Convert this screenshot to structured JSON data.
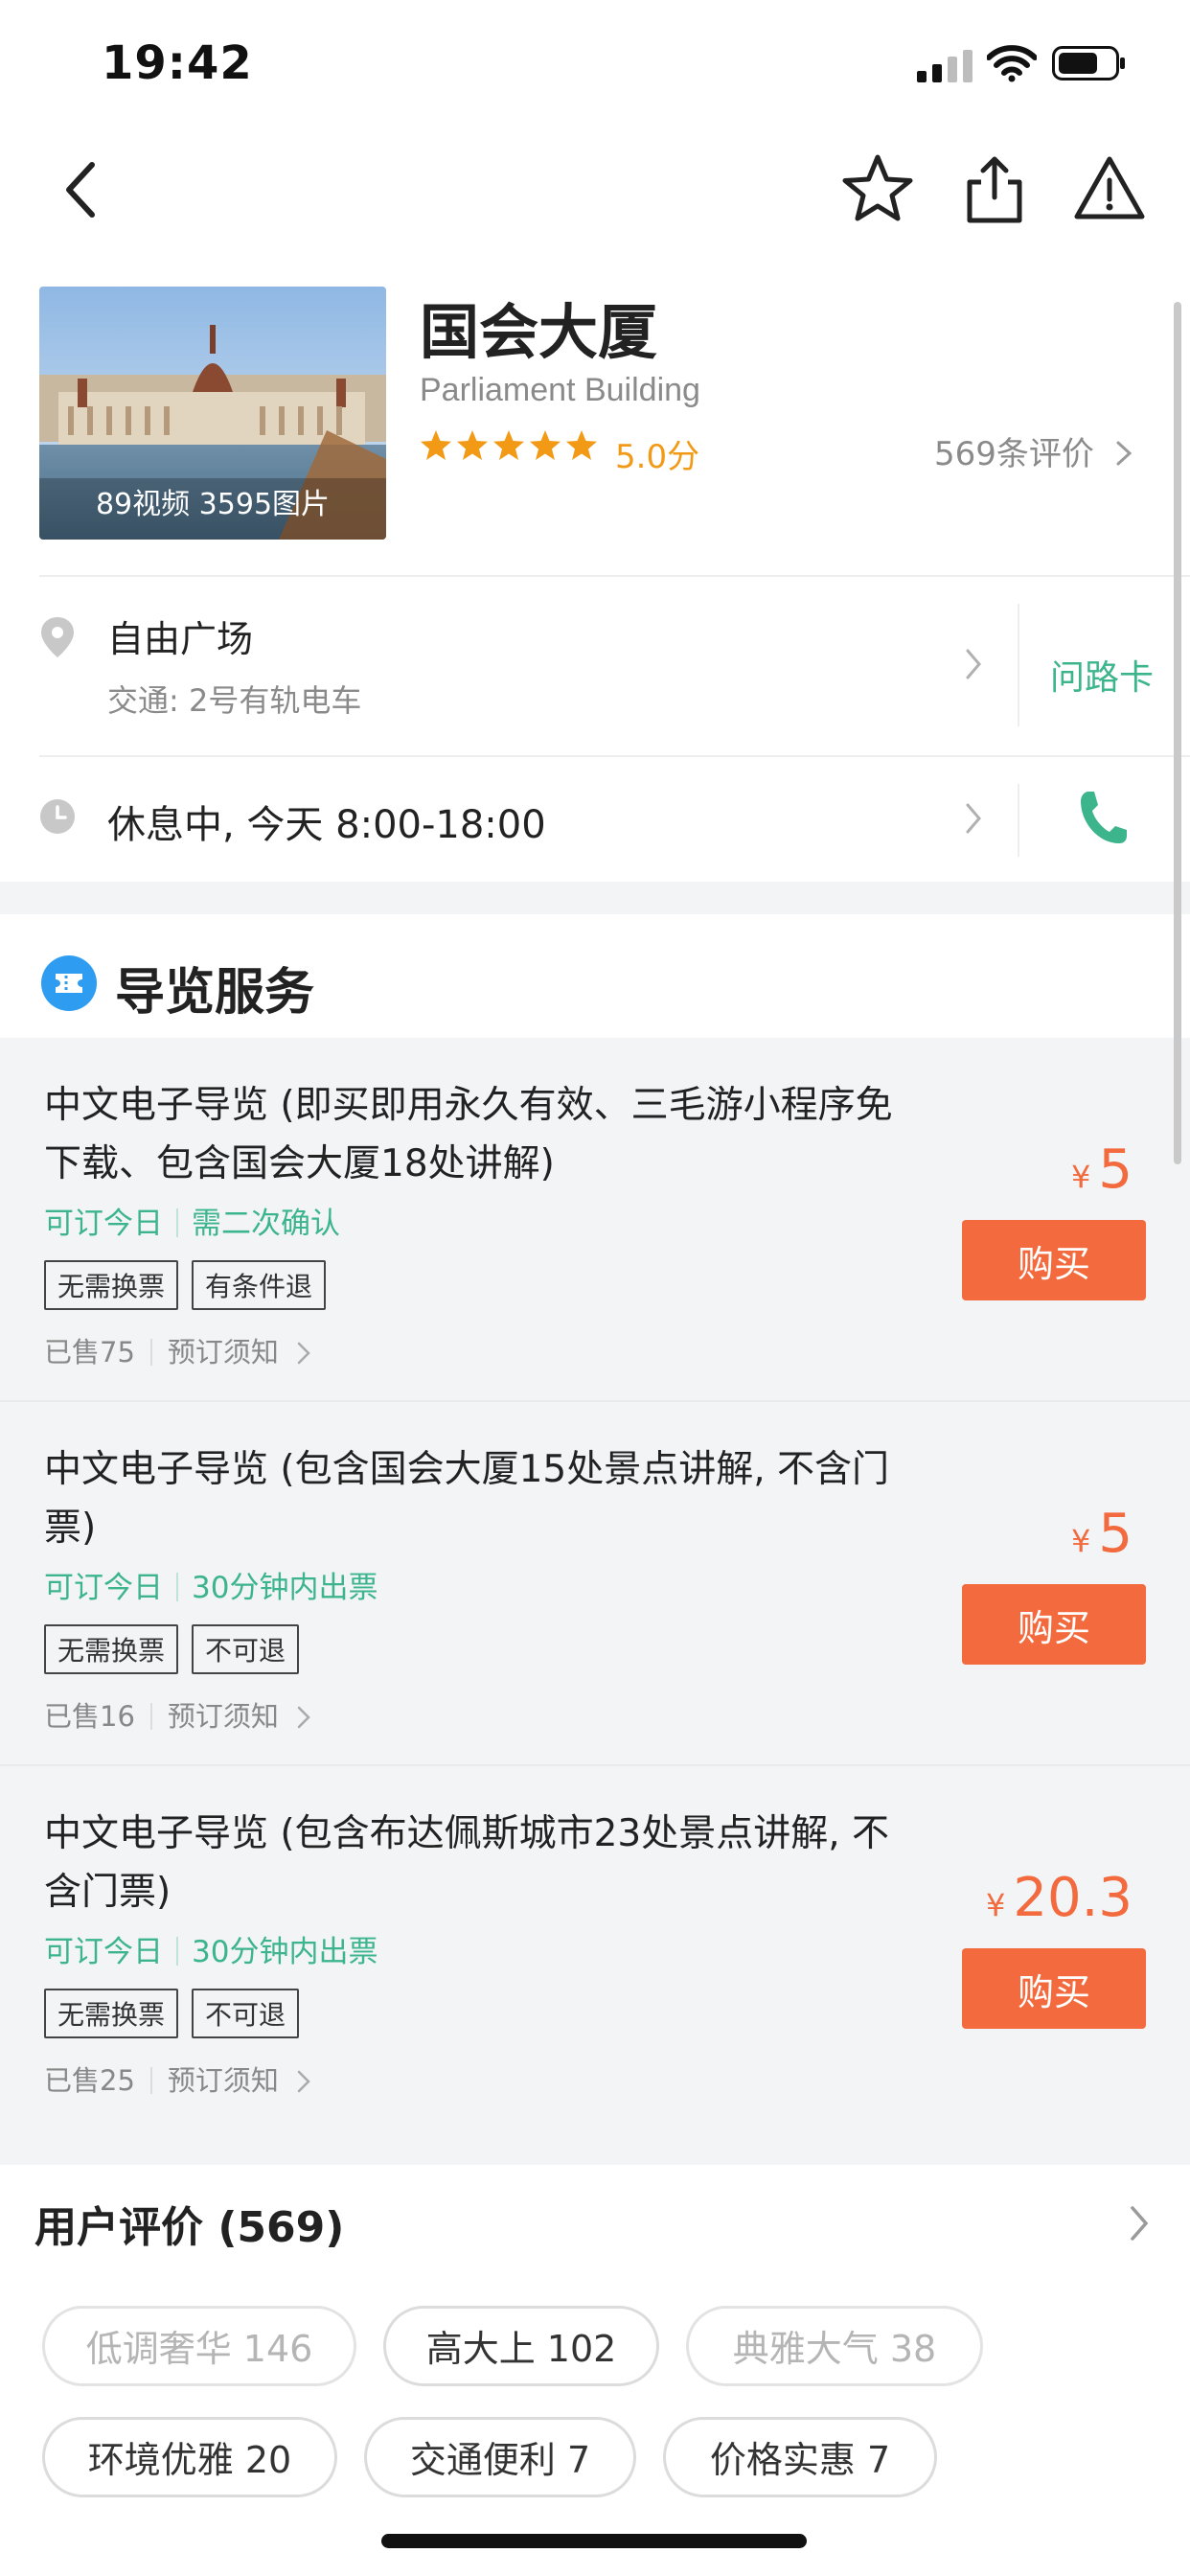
{
  "status": {
    "time": "19:42"
  },
  "attraction": {
    "name": "国会大厦",
    "name_en": "Parliament Building",
    "rating": "5.0分",
    "stars": 5,
    "reviews": "569条评价",
    "media": "89视频 3595图片"
  },
  "location": {
    "place": "自由广场",
    "transport": "交通: 2号有轨电车",
    "direction_card": "问路卡"
  },
  "hours": {
    "text": "休息中, 今天 8:00-18:00"
  },
  "guide": {
    "title": "导览服务",
    "items": [
      {
        "title": "中文电子导览 (即买即用永久有效、三毛游小程序免下载、包含国会大厦18处讲解)",
        "tag1": "可订今日",
        "tag2": "需二次确认",
        "chip1": "无需换票",
        "chip2": "有条件退",
        "sold": "已售75",
        "notice": "预订须知",
        "price": "5",
        "yen": "¥",
        "buy": "购买"
      },
      {
        "title": "中文电子导览 (包含国会大厦15处景点讲解, 不含门票)",
        "tag1": "可订今日",
        "tag2": "30分钟内出票",
        "chip1": "无需换票",
        "chip2": "不可退",
        "sold": "已售16",
        "notice": "预订须知",
        "price": "5",
        "yen": "¥",
        "buy": "购买"
      },
      {
        "title": "中文电子导览 (包含布达佩斯城市23处景点讲解, 不含门票)",
        "tag1": "可订今日",
        "tag2": "30分钟内出票",
        "chip1": "无需换票",
        "chip2": "不可退",
        "sold": "已售25",
        "notice": "预订须知",
        "price": "20.3",
        "yen": "¥",
        "buy": "购买"
      }
    ]
  },
  "user_reviews": {
    "title": "用户评价 (569)",
    "tags": [
      {
        "label": "低调奢华 146",
        "muted": true
      },
      {
        "label": "高大上 102",
        "muted": false
      },
      {
        "label": "典雅大气 38",
        "muted": true
      },
      {
        "label": "环境优雅 20",
        "muted": false
      },
      {
        "label": "交通便利 7",
        "muted": false
      },
      {
        "label": "价格实惠 7",
        "muted": false
      }
    ]
  },
  "colors": {
    "accent": "#f26a3d",
    "green": "#3cb48c",
    "star": "#f29a16",
    "guide_icon": "#2e9cf0"
  }
}
